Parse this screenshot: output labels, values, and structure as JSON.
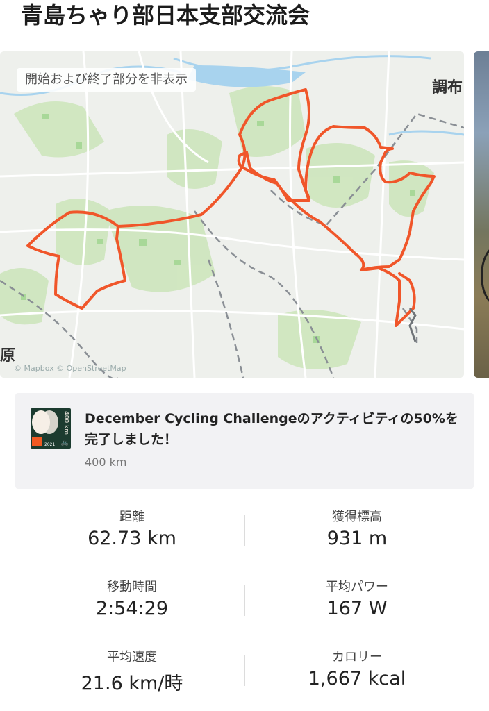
{
  "header": {
    "title": "青島ちゃり部日本支部交流会"
  },
  "map": {
    "toggle_label": "開始および終了部分を非表示",
    "place_labels": {
      "chofu": "調布",
      "hara": "原"
    },
    "attribution": "© Mapbox © OpenStreetMap",
    "route_color": "#f0562a"
  },
  "challenge": {
    "title": "December Cycling Challengeのアクティビティの50%を完了しました！",
    "subtitle": "400 km",
    "badge": {
      "distance": "400 km",
      "year": "2021",
      "icon": "bicycle-icon"
    }
  },
  "stats": {
    "distance": {
      "label": "距離",
      "value": "62.73 km"
    },
    "elevation_gain": {
      "label": "獲得標高",
      "value": "931 m"
    },
    "moving_time": {
      "label": "移動時間",
      "value": "2:54:29"
    },
    "avg_power": {
      "label": "平均パワー",
      "value": "167 W"
    },
    "avg_speed": {
      "label": "平均速度",
      "value": "21.6 km/時"
    },
    "calories": {
      "label": "カロリー",
      "value": "1,667 kcal"
    }
  }
}
